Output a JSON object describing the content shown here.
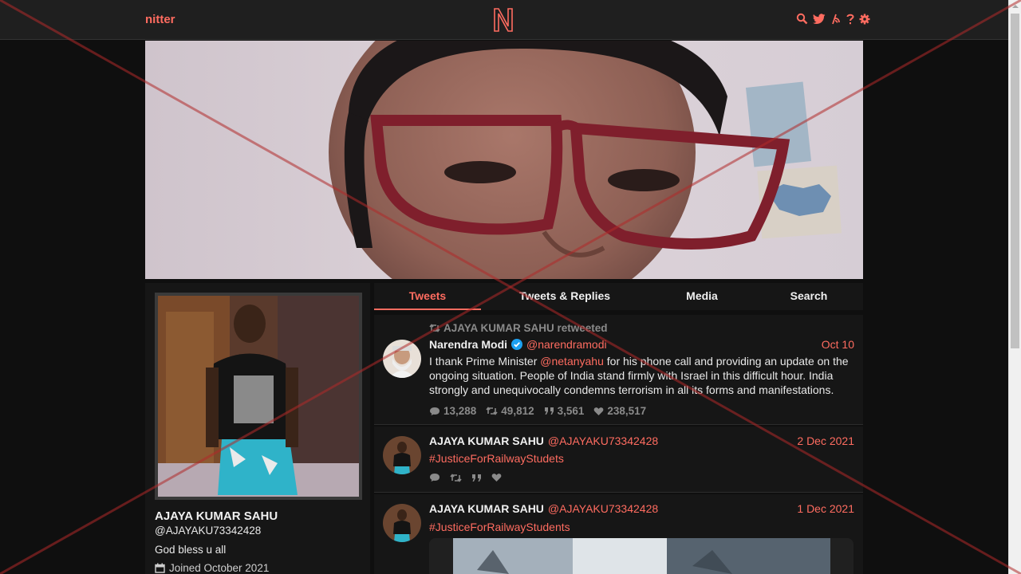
{
  "nav": {
    "brand": "nitter",
    "icons": [
      "search-icon",
      "twitter-icon",
      "rss-icon",
      "help-icon",
      "settings-icon"
    ]
  },
  "profile": {
    "fullname": "AJAYA KUMAR SAHU",
    "username": "@AJAYAKU73342428",
    "bio": "God bless u all",
    "joined": "Joined October 2021"
  },
  "tabs": [
    {
      "label": "Tweets",
      "active": true
    },
    {
      "label": "Tweets & Replies",
      "active": false
    },
    {
      "label": "Media",
      "active": false
    },
    {
      "label": "Search",
      "active": false
    }
  ],
  "tweets": [
    {
      "retweet_by": "AJAYA KUMAR SAHU retweeted",
      "name": "Narendra Modi",
      "verified": true,
      "handle": "@narendramodi",
      "date": "Oct 10",
      "text_before": "I thank Prime Minister ",
      "mention": "@netanyahu",
      "text_after": " for his phone call and providing an update on the ongoing situation. People of India stand firmly with Israel in this difficult hour. India strongly and unequivocally condemns terrorism in all its forms and manifestations.",
      "stats": {
        "replies": "13,288",
        "retweets": "49,812",
        "quotes": "3,561",
        "likes": "238,517"
      }
    },
    {
      "name": "AJAYA KUMAR SAHU",
      "handle": "@AJAYAKU73342428",
      "date": "2 Dec 2021",
      "hashtag": "#JusticeForRailwayStudets"
    },
    {
      "name": "AJAYA KUMAR SAHU",
      "handle": "@AJAYAKU73342428",
      "date": "1 Dec 2021",
      "hashtag": "#JusticeForRailwayStudents"
    }
  ],
  "colors": {
    "accent": "#ff6c60",
    "background": "#0f0f0f",
    "panel": "#161616",
    "navbar": "#1f1f1f",
    "overlay_cross": "#b02a2a"
  }
}
